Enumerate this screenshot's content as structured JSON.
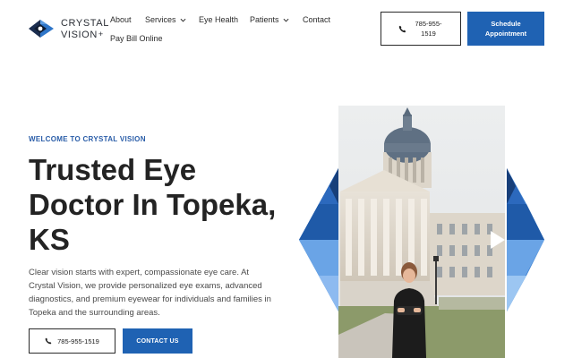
{
  "brand": {
    "line1": "CRYSTAL",
    "line2": "VISION",
    "colors": {
      "accent": "#1f62b3",
      "dark": "#232323"
    }
  },
  "nav": {
    "about": "About",
    "services": "Services",
    "eye_health": "Eye Health",
    "patients": "Patients",
    "contact": "Contact",
    "pay_bill": "Pay Bill Online"
  },
  "header_actions": {
    "phone": "785-955-1519",
    "schedule": "Schedule Appointment"
  },
  "hero": {
    "eyebrow": "WELCOME TO CRYSTAL VISION",
    "title": "Trusted Eye Doctor In Topeka, KS",
    "description": "Clear vision starts with expert, compassionate eye care. At Crystal Vision, we provide personalized eye exams, advanced diagnostics, and premium eyewear for individuals and families in Topeka and the surrounding areas.",
    "phone_button": "785-955-1519",
    "contact_button": "CONTACT US"
  },
  "icons": {
    "logo": "diamond-eye-logo-icon",
    "phone": "phone-icon",
    "dropdown": "chevron-down-icon"
  }
}
